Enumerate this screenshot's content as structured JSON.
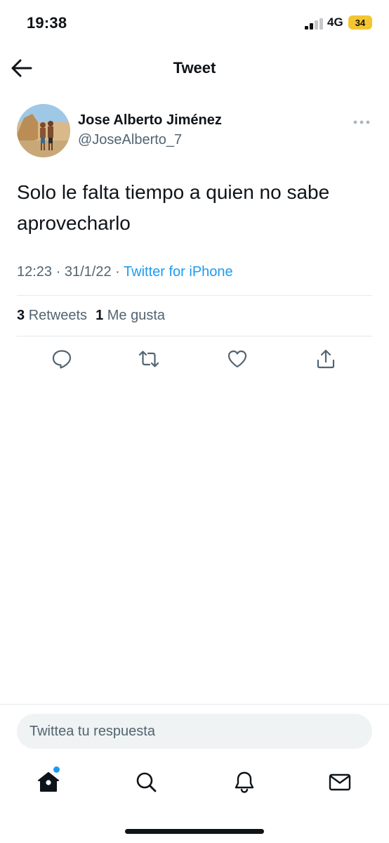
{
  "status_bar": {
    "time": "19:38",
    "network": "4G",
    "battery": "34",
    "battery_color": "#f4c531"
  },
  "header": {
    "title": "Tweet",
    "back_icon": "arrow-left-icon"
  },
  "tweet": {
    "author_name": "Jose Alberto Jiménez",
    "author_handle": "@JoseAlberto_7",
    "text": "Solo le falta tiempo a quien no sabe aprovecharlo",
    "time": "12:23",
    "separator": "·",
    "date": "31/1/22",
    "source": "Twitter for iPhone",
    "retweets_count": "3",
    "retweets_label": "Retweets",
    "likes_count": "1",
    "likes_label": "Me gusta"
  },
  "actions": [
    "reply-icon",
    "retweet-icon",
    "like-icon",
    "share-icon"
  ],
  "reply_box": {
    "placeholder": "Twittea tu respuesta"
  },
  "tab_bar": [
    "home-icon",
    "search-icon",
    "bell-icon",
    "mail-icon"
  ],
  "colors": {
    "accent": "#1d9bf0",
    "text_primary": "#0f1419",
    "text_secondary": "#536471"
  }
}
